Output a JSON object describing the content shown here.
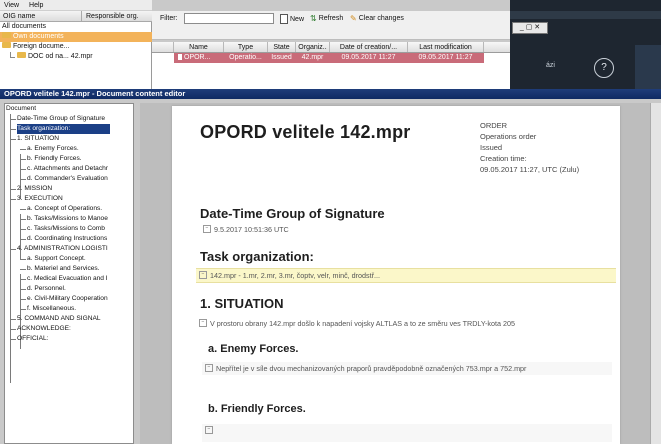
{
  "menubar": {
    "items": [
      "View",
      "Help"
    ]
  },
  "docs_panel": {
    "col1": "OIG name",
    "col2": "Responsible org.",
    "rows": [
      {
        "label": "All documents",
        "indent": 0,
        "selected": false,
        "folder": false
      },
      {
        "label": "Own documents",
        "indent": 1,
        "selected": true,
        "folder": true
      },
      {
        "label": "Foreign docume...",
        "indent": 1,
        "selected": false,
        "folder": true
      },
      {
        "label": "DOC od na...  42.mpr",
        "indent": 2,
        "selected": false,
        "folder": true
      }
    ]
  },
  "filter_bar": {
    "label": "Filter:",
    "value": "",
    "new_label": "New",
    "refresh_label": "Refresh",
    "clear_label": "Clear changes"
  },
  "grid": {
    "columns": [
      "Name",
      "Type",
      "State",
      "Organiz..",
      "Date of creation/...",
      "Last modification"
    ],
    "row": [
      "OPOR...",
      "Operatio...",
      "Issued",
      "42.mpr",
      "09.05.2017 11:27",
      "09.05.2017 11:27"
    ]
  },
  "dark_app": {
    "window_buttons": "_ ▢ ✕",
    "text": "ázi",
    "help_glyph": "?"
  },
  "editor": {
    "title": "OPORD velitele 142.mpr - Document content editor"
  },
  "tree": [
    "Document",
    "Date-Time Group of Signature",
    "Task organization:",
    "1. SITUATION",
    "a. Enemy Forces.",
    "b. Friendly Forces.",
    "c. Attachments and Detachr",
    "d. Commander's Evaluation",
    "2. MISSION",
    "3. EXECUTION",
    "a. Concept of Operations.",
    "b. Tasks/Missions to Manoe",
    "c. Tasks/Missions to Comb",
    "d. Coordinating Instructions",
    "4. ADMINISTRATION LOGISTI",
    "a. Support Concept.",
    "b. Materiel and Services.",
    "c. Medical Evacuation and I",
    "d. Personnel.",
    "e. Civil-Military Cooperation",
    "f. Miscellaneous.",
    "5. COMMAND AND SIGNAL",
    "ACKNOWLEDGE:",
    "OFFICIAL:"
  ],
  "document": {
    "title": "OPORD velitele 142.mpr",
    "meta": [
      "ORDER",
      "Operations order",
      "Issued",
      "Creation time:",
      "09.05.2017 11:27, UTC (Zulu)"
    ],
    "dtg_heading": "Date-Time Group of Signature",
    "dtg_value": "9.5.2017 10:51:36 UTC",
    "task_heading": "Task organization:",
    "task_value": "142.mpr - 1.mr, 2.mr, 3.mr, čoptv, velr, minč, drodstř...",
    "situation_heading": "1. SITUATION",
    "situation_text": "V prostoru obrany 142.mpr došlo k napadení vojsky ALTLAS a to ze směru ves TRDLY-kota 205",
    "enemy_heading": "a. Enemy Forces.",
    "enemy_text": "Nepřítel je v síle dvou mechanizovaných praporů pravděpodobně označených 753.mpr a 752.mpr",
    "friendly_heading": "b. Friendly Forces.",
    "marker": "⊟"
  }
}
